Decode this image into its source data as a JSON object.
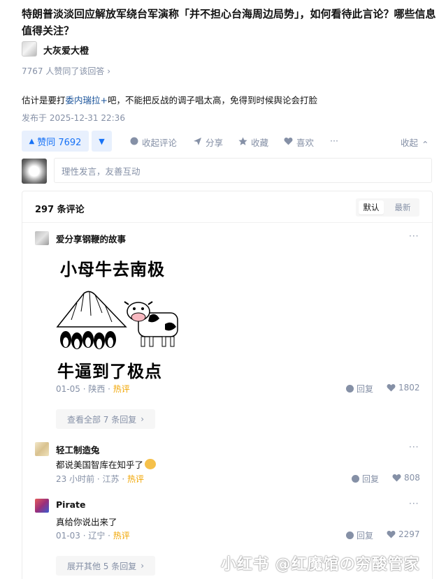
{
  "question": {
    "title": "特朗普淡淡回应解放军绕台军演称「并不担心台海周边局势」，如何看待此言论？哪些信息值得关注？"
  },
  "answer": {
    "author": "大灰爱大橙",
    "voters_text": "7767 人赞同了该回答",
    "voters_chevron": "›",
    "content_before": "估计是要打",
    "content_link": "委内瑞拉+",
    "content_after": "吧，不能把反战的调子唱太高，免得到时候舆论会打脸",
    "published": "发布于 2025-12-31 22:36"
  },
  "actions": {
    "vote_label": "赞同 7692",
    "vote_up_icon": "▲",
    "vote_down_icon": "▼",
    "collapse_comments": "收起评论",
    "share": "分享",
    "favorite": "收藏",
    "like": "喜欢",
    "more": "···",
    "fold": "收起",
    "fold_chevron": "⌃"
  },
  "comment_input": {
    "placeholder": "理性发言，友善互动"
  },
  "comments_panel": {
    "count_label": "297 条评论",
    "sort_default": "默认",
    "sort_newest": "最新",
    "reply_label": "回复"
  },
  "comments": [
    {
      "author": "爱分享钢鞭的故事",
      "meme_top_text": "小母牛去南极",
      "meme_bottom_text": "牛逼到了极点",
      "date": "01-05",
      "location": "陕西",
      "hot": "热评",
      "likes": "1802",
      "expand_label": "查看全部 7 条回复"
    },
    {
      "author": "轻工制造兔",
      "text": "都说美国智库在知乎了",
      "time": "23 小时前",
      "location": "江苏",
      "hot": "热评",
      "likes": "808"
    },
    {
      "author": "Pirate",
      "text": "真给你说出来了",
      "date": "01-03",
      "location": "辽宁",
      "hot": "热评",
      "likes": "2297",
      "expand_label": "展开其他 5 条回复"
    }
  ],
  "watermark": "小红书 @红魔馆の穷酸管家",
  "colors": {
    "accent": "#1772f6",
    "muted": "#8590a6",
    "hot": "#f1a501",
    "link": "#175199"
  }
}
